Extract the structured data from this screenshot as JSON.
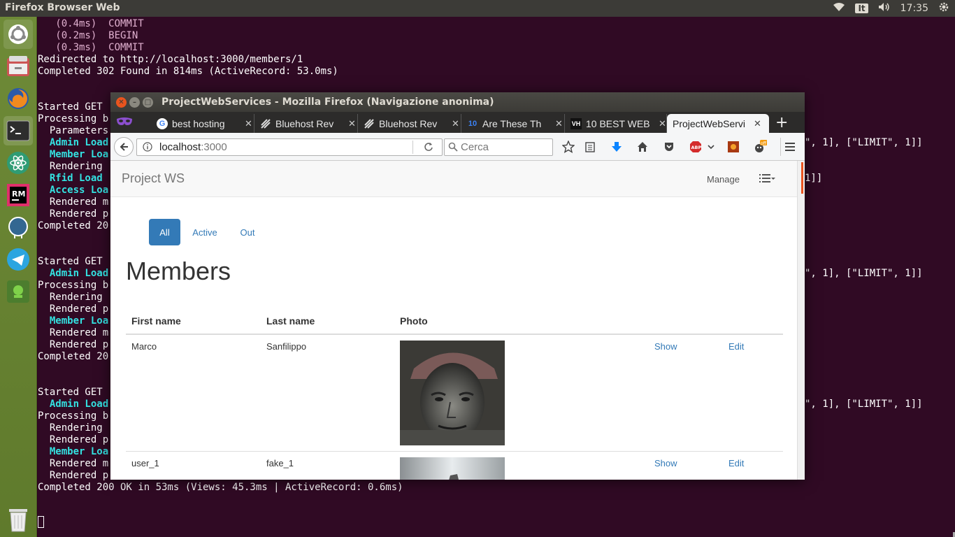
{
  "topbar": {
    "title": "Firefox Browser Web",
    "lang": "It",
    "time": "17:35"
  },
  "terminal": {
    "lines_top": [
      "   (0.4ms)  COMMIT",
      "   (0.2ms)  BEGIN",
      "   (0.3ms)  COMMIT",
      "Redirected to http://localhost:3000/members/1",
      "Completed 302 Found in 814ms (ActiveRecord: 53.0ms)"
    ],
    "left_lines": [
      {
        "text": "Started GET",
        "cls": "wt"
      },
      {
        "text": "Processing b",
        "cls": "wt"
      },
      {
        "text": "  Parameters",
        "cls": "wt"
      },
      {
        "text": "  Admin Load",
        "cls": "cy"
      },
      {
        "text": "  Member Loa",
        "cls": "cy"
      },
      {
        "text": "  Rendering",
        "cls": "wt"
      },
      {
        "text": "  Rfid Load",
        "cls": "cy"
      },
      {
        "text": "  Access Loa",
        "cls": "cy"
      },
      {
        "text": "  Rendered m",
        "cls": "wt"
      },
      {
        "text": "  Rendered p",
        "cls": "wt"
      },
      {
        "text": "Completed 20",
        "cls": "wt"
      },
      {
        "text": "",
        "cls": "wt"
      },
      {
        "text": "",
        "cls": "wt"
      },
      {
        "text": "Started GET",
        "cls": "wt"
      },
      {
        "text": "  Admin Load",
        "cls": "cy"
      },
      {
        "text": "Processing b",
        "cls": "wt"
      },
      {
        "text": "  Rendering",
        "cls": "wt"
      },
      {
        "text": "  Rendered p",
        "cls": "wt"
      },
      {
        "text": "  Member Loa",
        "cls": "cy"
      },
      {
        "text": "  Rendered m",
        "cls": "wt"
      },
      {
        "text": "  Rendered p",
        "cls": "wt"
      },
      {
        "text": "Completed 20",
        "cls": "wt"
      },
      {
        "text": "",
        "cls": "wt"
      },
      {
        "text": "",
        "cls": "wt"
      },
      {
        "text": "Started GET",
        "cls": "wt"
      },
      {
        "text": "  Admin Load",
        "cls": "cy"
      },
      {
        "text": "Processing b",
        "cls": "wt"
      },
      {
        "text": "  Rendering",
        "cls": "wt"
      },
      {
        "text": "  Rendered p",
        "cls": "wt"
      },
      {
        "text": "  Member Loa",
        "cls": "cy"
      },
      {
        "text": "  Rendered m",
        "cls": "wt"
      },
      {
        "text": "  Rendered p",
        "cls": "wt"
      }
    ],
    "right_lines": [
      "\", 1], [\"LIMIT\", 1]]",
      "1]]",
      "\", 1], [\"LIMIT\", 1]]",
      "\", 1], [\"LIMIT\", 1]]"
    ],
    "last_line": "Completed 200 OK in 53ms (Views: 45.3ms | ActiveRecord: 0.6ms)"
  },
  "firefox": {
    "window_title": "ProjectWebServices - Mozilla Firefox (Navigazione anonima)",
    "tabs": [
      {
        "label": "best hosting",
        "icon": "G"
      },
      {
        "label": "Bluehost Rev",
        "icon": "B"
      },
      {
        "label": "Bluehost Rev",
        "icon": "B"
      },
      {
        "label": "Are These Th",
        "icon": "10"
      },
      {
        "label": "10 BEST WEB",
        "icon": "VH"
      },
      {
        "label": "ProjectWebServi",
        "icon": ""
      }
    ],
    "new_tab": "+",
    "url_host": "localhost",
    "url_port": ":3000",
    "search_placeholder": "Cerca",
    "abp_label": "ABP",
    "off_badge": "off"
  },
  "page": {
    "brand": "Project WS",
    "manage": "Manage",
    "pills": [
      "All",
      "Active",
      "Out"
    ],
    "heading": "Members",
    "columns": [
      "First name",
      "Last name",
      "Photo"
    ],
    "rows": [
      {
        "first": "Marco",
        "last": "Sanfilippo",
        "show": "Show",
        "edit": "Edit"
      },
      {
        "first": "user_1",
        "last": "fake_1",
        "show": "Show",
        "edit": "Edit"
      }
    ]
  },
  "colors": {
    "terminal_bg": "#300a24",
    "link": "#337ab7",
    "launcher": "#6e8a37"
  }
}
